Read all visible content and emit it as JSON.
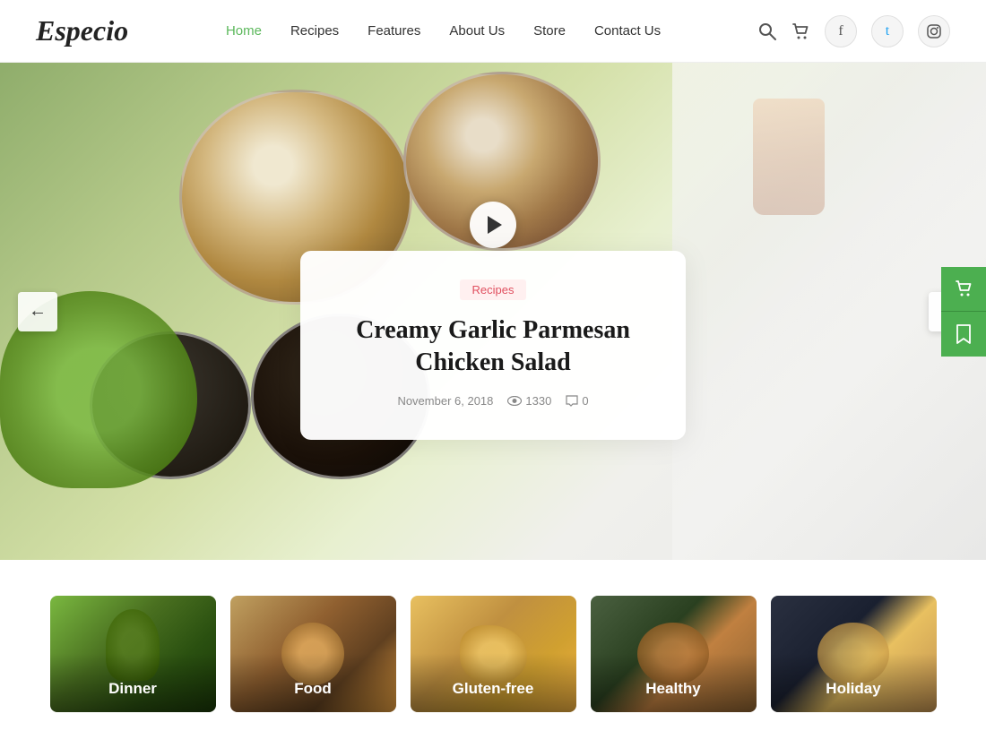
{
  "header": {
    "logo": "Especio",
    "nav": [
      {
        "label": "Home",
        "active": true
      },
      {
        "label": "Recipes",
        "active": false
      },
      {
        "label": "Features",
        "active": false
      },
      {
        "label": "About Us",
        "active": false
      },
      {
        "label": "Store",
        "active": false
      },
      {
        "label": "Contact Us",
        "active": false
      }
    ],
    "social": [
      "f",
      "t",
      "in"
    ]
  },
  "hero": {
    "arrow_left": "←",
    "arrow_right": "→",
    "card": {
      "tag": "Recipes",
      "title": "Creamy Garlic Parmesan\nChicken Salad",
      "date": "November 6, 2018",
      "views": "1330",
      "comments": "0"
    }
  },
  "categories": {
    "items": [
      {
        "label": "Dinner",
        "bg": "cat-dinner"
      },
      {
        "label": "Food",
        "bg": "cat-food"
      },
      {
        "label": "Gluten-free",
        "bg": "cat-gluten"
      },
      {
        "label": "Healthy",
        "bg": "cat-healthy"
      },
      {
        "label": "Holiday",
        "bg": "cat-holiday"
      }
    ]
  },
  "colors": {
    "nav_active": "#5cb85c",
    "tag_bg": "#fff0f0",
    "tag_text": "#e05060",
    "side_btn": "#4caf50"
  }
}
